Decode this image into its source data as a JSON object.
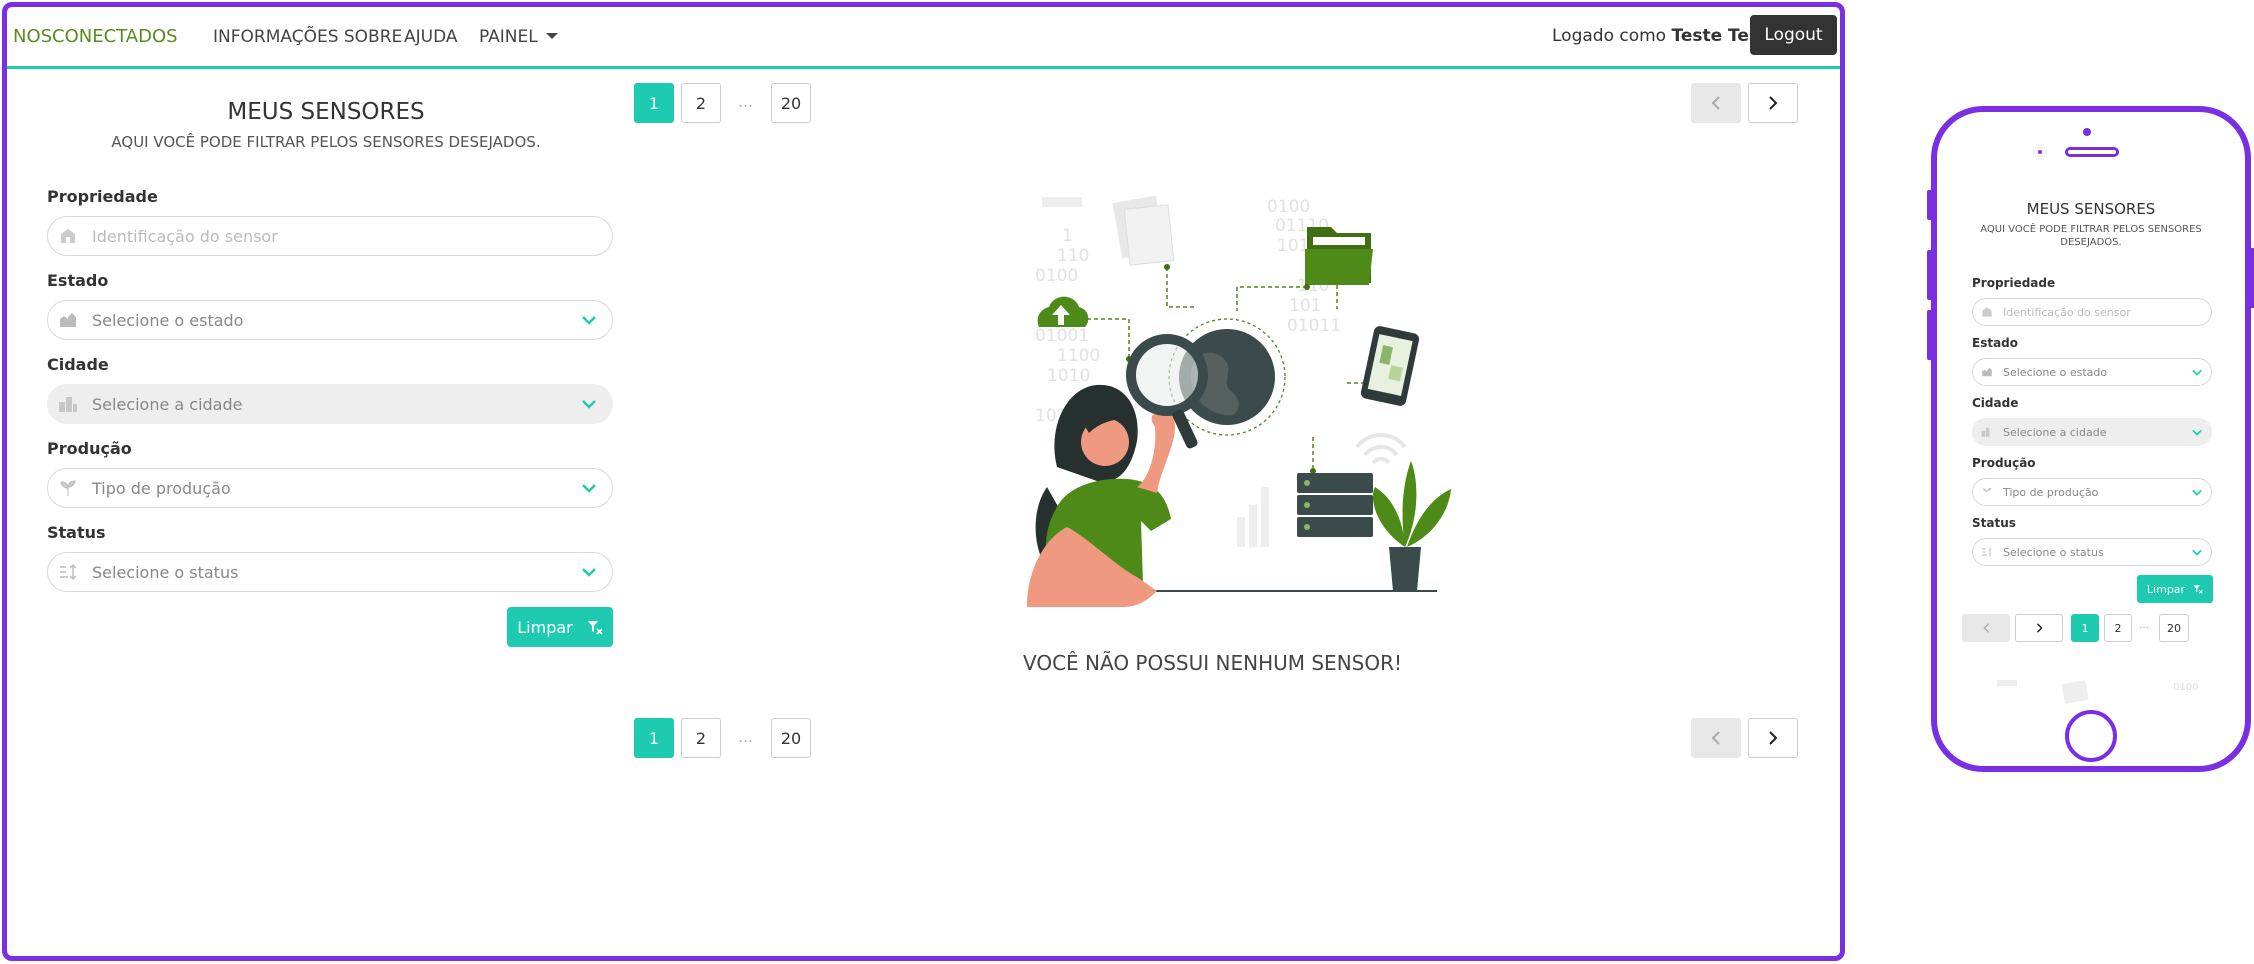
{
  "nav": {
    "brand": "NOSCONECTADOS",
    "links": [
      "INFORMAÇÕES SOBRE",
      "AJUDA",
      "PAINEL"
    ],
    "logged_prefix": "Logado como",
    "user_name": "Teste Teste",
    "logout": "Logout"
  },
  "filter": {
    "title": "MEUS SENSORES",
    "subtitle": "AQUI VOCÊ PODE FILTRAR PELOS SENSORES DESEJADOS.",
    "fields": [
      {
        "label": "Propriedade",
        "placeholder": "Identificação do sensor",
        "icon": "property-icon"
      },
      {
        "label": "Estado",
        "placeholder": "Selecione o estado",
        "icon": "map-state-icon"
      },
      {
        "label": "Cidade",
        "placeholder": "Selecione a cidade",
        "icon": "city-icon"
      },
      {
        "label": "Produção",
        "placeholder": "Tipo de produção",
        "icon": "plant-icon"
      },
      {
        "label": "Status",
        "placeholder": "Selecione o status",
        "icon": "sort-icon"
      }
    ],
    "clear_button": "Limpar"
  },
  "pagination": {
    "pages": [
      "1",
      "2",
      "20"
    ],
    "ellipsis": "…",
    "current": "1"
  },
  "empty_message": "VOCÊ NÃO POSSUI NENHUM SENSOR!",
  "illustration_text": {
    "binary_lines": [
      "0100",
      "01110",
      "1010",
      "110",
      "101",
      "01011",
      "1",
      "110",
      "0100",
      "01001",
      "1100",
      "1010",
      "1010"
    ]
  },
  "mobile": {
    "title": "MEUS SENSORES",
    "subtitle_line1": "AQUI VOCÊ PODE FILTRAR PELOS SENSORES",
    "subtitle_line2": "DESEJADOS.",
    "clear_button": "Limpar",
    "peek_text": "0100"
  },
  "colors": {
    "accent": "#1ecbb0",
    "frame": "#7a2fe2",
    "brand": "#5b8b1f",
    "dark_button": "#333333"
  }
}
